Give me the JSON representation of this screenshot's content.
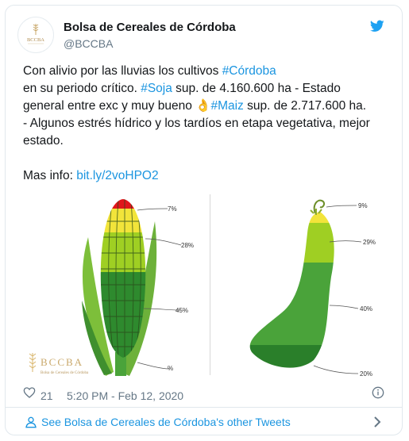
{
  "header": {
    "name": "Bolsa de Cereales de Córdoba",
    "handle": "@BCCBA",
    "avatar_logo_text": "BCCBA"
  },
  "tweet": {
    "line1_prefix": "Con alivio por las lluvias los cultivos ",
    "line1_tag": "#Córdoba",
    "line2_prefix": "en su periodo crítico. ",
    "line2_tag": "#Soja",
    "line2_suffix": " sup. de 4.160.600 ha - Estado",
    "line3_prefix": "general entre exc y muy bueno ",
    "line3_emoji": "👌",
    "line3_tag": "#Maiz",
    "line3_suffix": " sup. de 2.717.600 ha.",
    "line4": "- Algunos estrés hídrico y los tardíos en etapa vegetativa, mejor",
    "line5": "estado.",
    "more_info_label": "Mas info: ",
    "more_info_link": "bit.ly/2voHPO2"
  },
  "media": {
    "logo_text": "BCCBA",
    "logo_subtext": "Bolsa de Cereales de Córdoba",
    "corn_labels": [
      "7%",
      "28%",
      "45%",
      "%"
    ],
    "soy_labels": [
      "9%",
      "29%",
      "40%",
      "20%"
    ],
    "colors": {
      "red": "#e0161b",
      "yellow": "#f2e43a",
      "light_green": "#9fcf23",
      "mid_green": "#4aa33a",
      "dark_green": "#2e8a2e"
    }
  },
  "footer": {
    "likes": "21",
    "timestamp": "5:20 PM - Feb 12, 2020"
  },
  "more_tweets": {
    "label": "See Bolsa de Cereales de Córdoba's other Tweets"
  }
}
